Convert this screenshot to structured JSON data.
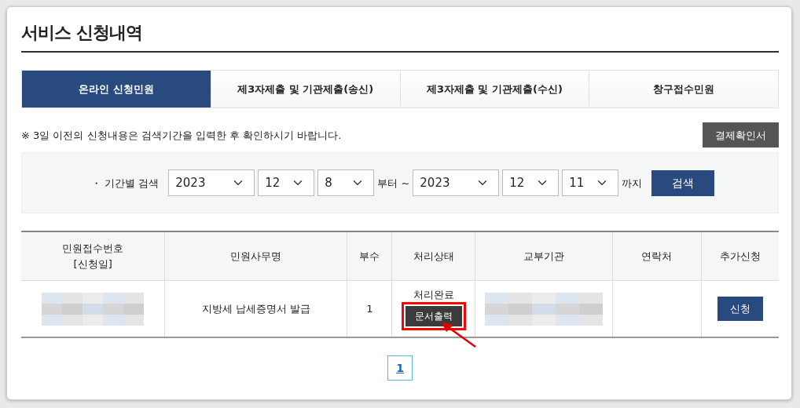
{
  "title": "서비스 신청내역",
  "tabs": [
    {
      "label": "온라인 신청민원",
      "selected": true
    },
    {
      "label": "제3자제출 및 기관제출(송신)",
      "selected": false
    },
    {
      "label": "제3자제출 및 기관제출(수신)",
      "selected": false
    },
    {
      "label": "창구접수민원",
      "selected": false
    }
  ],
  "notice": "※ 3일 이전의 신청내용은 검색기간을 입력한 후 확인하시기 바랍니다.",
  "payment_button": "결제확인서",
  "search": {
    "label": "・ 기간별 검색",
    "from": [
      "2023",
      "12",
      "8"
    ],
    "from_suffix": "부터 ~",
    "to": [
      "2023",
      "12",
      "11"
    ],
    "to_suffix": "까지",
    "button": "검색"
  },
  "table": {
    "columns": [
      "민원접수번호\n[신청일]",
      "민원사무명",
      "부수",
      "처리상태",
      "교부기관",
      "연락처",
      "추가신청"
    ],
    "rows": [
      {
        "receipt_redacted": true,
        "service": "지방세 납세증명서 발급",
        "copies": "1",
        "status": "처리완료",
        "print_button": "문서출력",
        "print_highlighted": true,
        "agency_redacted": true,
        "apply_button": "신청"
      }
    ]
  },
  "pagination": [
    {
      "label": "1",
      "selected": true
    }
  ]
}
